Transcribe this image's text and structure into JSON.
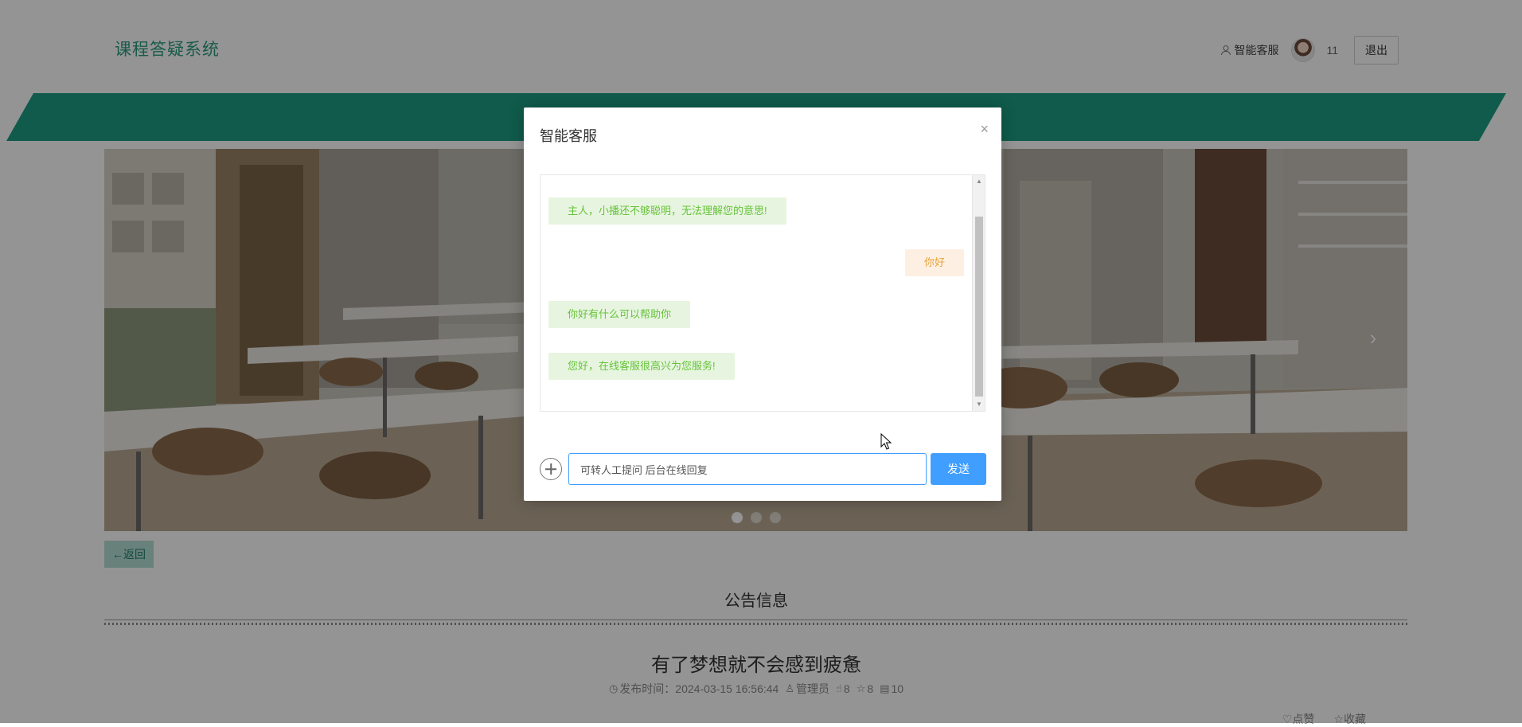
{
  "header": {
    "logo": "课程答疑系统",
    "service_link": "智能客服",
    "username": "11",
    "logout": "退出"
  },
  "banner": {
    "next_arrow": "›",
    "slides_count": 3,
    "active_slide": 1
  },
  "content": {
    "back_label": "←返回",
    "section_title": "公告信息",
    "article_title": "有了梦想就不会感到疲惫",
    "publish_label": "发布时间：2024-03-15 16:56:44",
    "author": "管理员",
    "likes": "8",
    "favorites": "8",
    "views": "10",
    "like_action": "点赞",
    "favorite_action": "收藏"
  },
  "dialog": {
    "title": "智能客服",
    "close": "×",
    "messages": [
      {
        "from": "bot",
        "text": "主人，小播还不够聪明，无法理解您的意思!"
      },
      {
        "from": "user",
        "text": "你好"
      },
      {
        "from": "bot",
        "text": "你好有什么可以帮助你"
      },
      {
        "from": "bot",
        "text": "您好，在线客服很高兴为您服务!"
      }
    ],
    "input_value": "可转人工提问 后台在线回复",
    "send": "发送"
  },
  "colors": {
    "brand_green": "#1d9e82",
    "send_blue": "#409eff",
    "bot_text": "#67c23a",
    "user_text": "#e6a23c"
  }
}
